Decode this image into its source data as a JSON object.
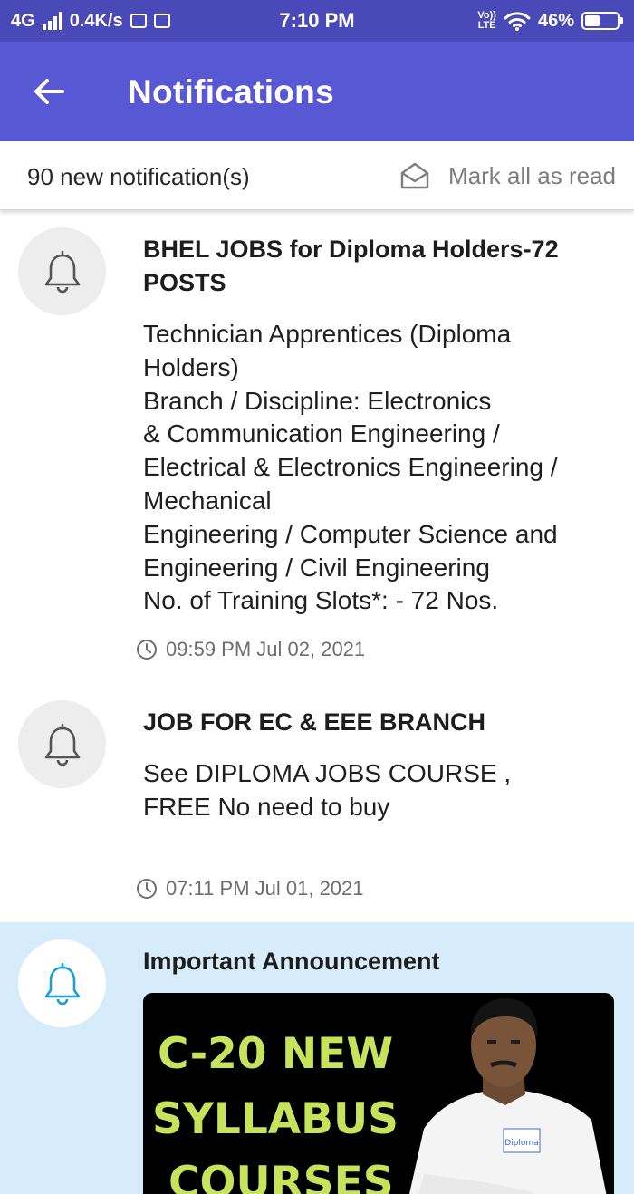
{
  "status_bar": {
    "network": "4G",
    "speed": "0.4K/s",
    "time": "7:10 PM",
    "volte_top": "Vo))",
    "volte_bottom": "LTE",
    "battery": "46%",
    "battery_level": 0.46
  },
  "app_bar": {
    "back_icon": "arrow-back-icon",
    "title": "Notifications"
  },
  "summary": {
    "count_text": "90 new notification(s)",
    "mark_all_icon": "envelope-open-icon",
    "mark_all_label": "Mark all as read"
  },
  "notifications": [
    {
      "icon": "bell-icon",
      "title": "BHEL JOBS for Diploma Holders-72 POSTS",
      "body": "Technician Apprentices (Diploma\nHolders)\nBranch / Discipline: Electronics\n& Communication Engineering /\nElectrical & Electronics Engineering /\nMechanical\nEngineering / Computer Science and\nEngineering / Civil Engineering\nNo. of Training Slots*: - 72 Nos.",
      "time": "09:59 PM Jul 02, 2021"
    },
    {
      "icon": "bell-icon",
      "title": "JOB FOR EC & EEE BRANCH",
      "body": "See DIPLOMA JOBS COURSE ,\nFREE No need to buy",
      "time": "07:11 PM Jul 01, 2021"
    },
    {
      "icon": "bell-icon",
      "title": "Important Announcement",
      "highlighted": true,
      "banner": {
        "line1": "C-20 NEW",
        "line2": "SYLLABUS",
        "line3": "COURSES",
        "logo_text": "Diploma"
      }
    }
  ],
  "colors": {
    "status_bar": "#4a49b8",
    "app_bar": "#5858d4",
    "highlight_bg": "#d7ecfa",
    "bell_unread": "#1b9ed6",
    "banner_text": "#c7e35b"
  }
}
